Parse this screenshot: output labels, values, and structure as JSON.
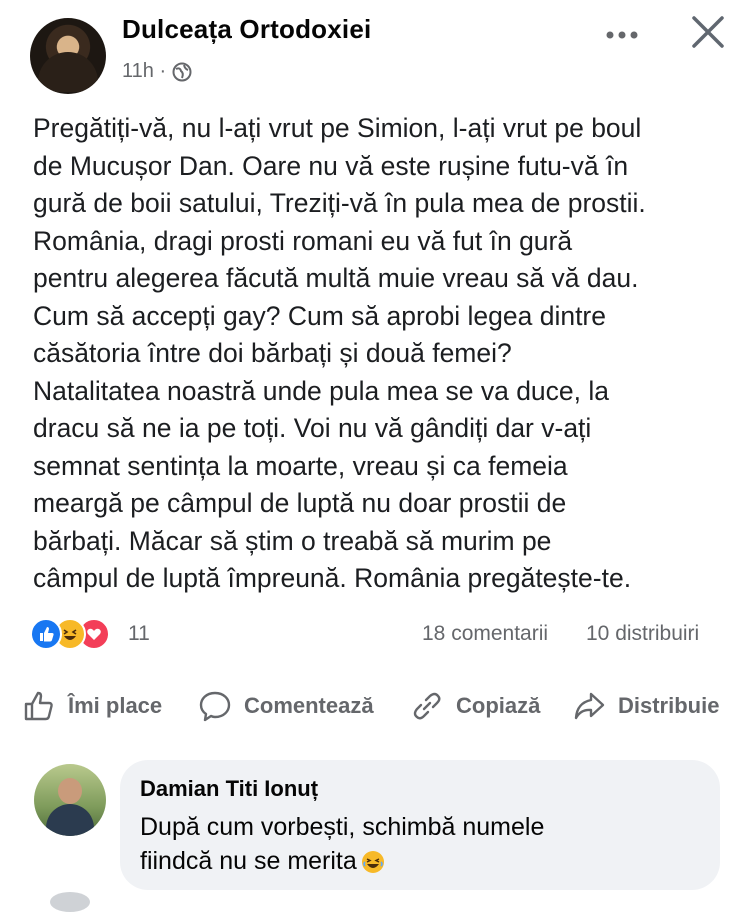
{
  "post": {
    "author": "Dulceața Ortodoxiei",
    "time": "11h ·",
    "audience_icon": "globe-icon",
    "text": "Pregătiți-vă, nu l-ați vrut pe Simion, l-ați vrut pe boul\nde Mucușor Dan. Oare nu vă este rușine futu-vă în\ngură de boii satului, Treziți-vă în pula mea de prostii.\nRomânia, dragi prosti romani eu vă fut în gură\npentru alegerea făcută multă muie vreau să vă dau.\nCum să accepți gay? Cum să aprobi legea dintre\ncăsătoria între doi bărbați și două femei?\nNatalitatea noastră unde pula mea se va duce, la\ndracu să ne ia pe toți. Voi nu vă gândiți dar v-ați\nsemnat sentința la moarte, vreau și ca femeia\nmeargă pe câmpul de luptă nu doar prostii de\nbărbați. Măcar să știm o treabă să murim pe\ncâmpul de luptă împreună. România pregătește-te."
  },
  "stats": {
    "reactions": [
      "like",
      "haha",
      "love"
    ],
    "reaction_count": "11",
    "comments": "18 comentarii",
    "shares": "10 distribuiri"
  },
  "actions": {
    "like": "Îmi place",
    "comment": "Comentează",
    "copy": "Copiază",
    "share": "Distribuie"
  },
  "comment": {
    "author": "Damian Titi Ionuț",
    "text": "După cum vorbești, schimbă numele\nfiindcă nu se merita"
  },
  "colors": {
    "accent": "#1877f2",
    "muted": "#65676b",
    "bubble": "#f0f2f5"
  }
}
